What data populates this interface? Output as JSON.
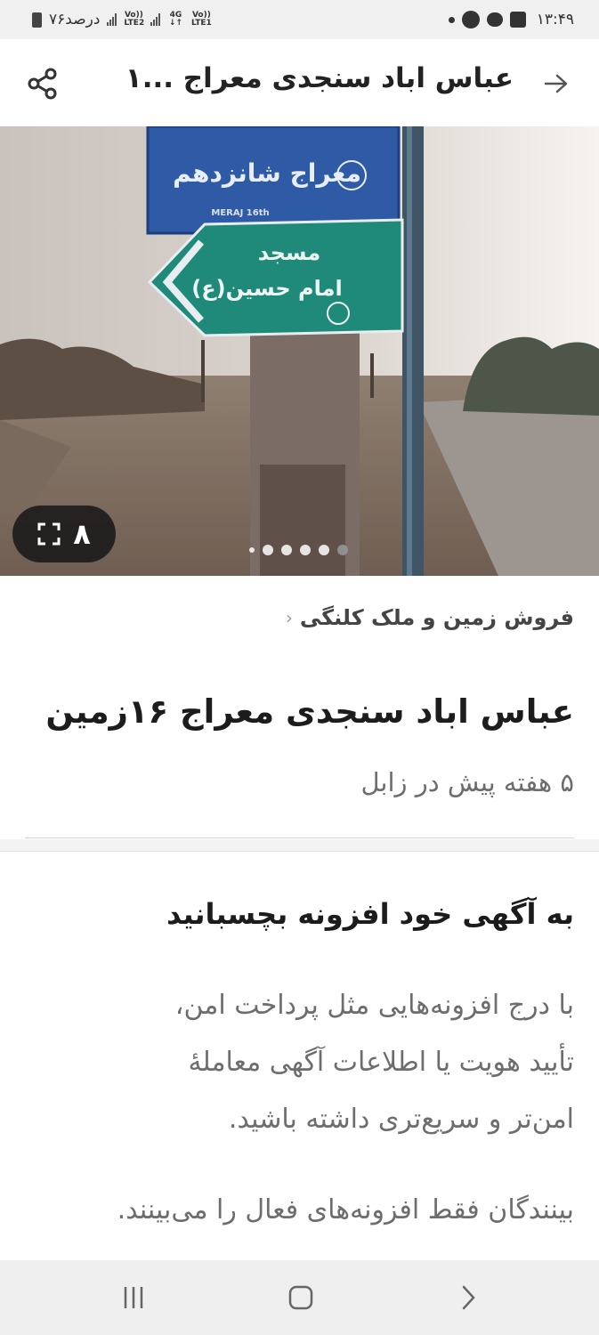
{
  "status_bar": {
    "battery": "۷۶درصد",
    "sim2": "Vo)) LTE2",
    "net1_top": "4G",
    "net1_bottom": "Vo)) LTE1",
    "time": "۱۳:۴۹",
    "icons": [
      "battery-icon",
      "signal-icon",
      "whatsapp-icon",
      "chat-icon",
      "gallery-icon"
    ]
  },
  "app_bar": {
    "title": "عباس اباد سنجدی معراج ...۱",
    "back_icon": "arrow-right-icon",
    "share_icon": "share-icon"
  },
  "photo": {
    "counter": "۸",
    "counter_icon": "fullscreen-icon",
    "dots": 6,
    "sign_blue_text": "معراج شانزدهم",
    "sign_blue_en": "MERAJ 16th",
    "sign_green_line1": "مسجد",
    "sign_green_line2": "امام حسین(ع)"
  },
  "breadcrumb": {
    "label": "فروش زمین و ملک کلنگی",
    "chevron": "‹"
  },
  "ad": {
    "title": "عباس اباد سنجدی معراج ۱۶زمین",
    "meta": "۵ هفته پیش در زابل"
  },
  "promo": {
    "title": "به آگهی خود افزونه بچسبانید",
    "lines": [
      "با درج افزونه‌هایی مثل پرداخت امن،",
      "تأیید هویت یا اطلاعات آگهی معاملهٔ",
      "امن‌تر و سریع‌تری داشته باشید."
    ],
    "note": "بینندگان فقط افزونه‌های فعال را می‌بینند."
  },
  "nav": {
    "icons": [
      "recents-icon",
      "home-icon",
      "back-nav-icon"
    ]
  },
  "colors": {
    "sign_blue": "#2d5aa8",
    "sign_green": "#1f8a7a",
    "text_primary": "#1c1c1c",
    "text_secondary": "#6d6d6d"
  }
}
